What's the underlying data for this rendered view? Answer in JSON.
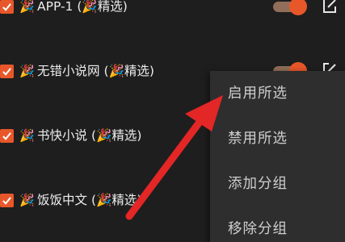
{
  "list": {
    "items": [
      {
        "name": "APP-1",
        "tag": "(",
        "tag_label": "精选",
        "tag_close": ")",
        "checked": true
      },
      {
        "name": "无错小说网",
        "tag": "(",
        "tag_label": "精选",
        "tag_close": ")",
        "checked": true
      },
      {
        "name": "书快小说",
        "tag": "(",
        "tag_label": "精选",
        "tag_close": ")",
        "checked": true
      },
      {
        "name": "饭饭中文",
        "tag": "(",
        "tag_label": "精选",
        "tag_close": ")",
        "checked": true
      }
    ]
  },
  "context_menu": {
    "items": [
      "启用所选",
      "禁用所选",
      "添加分组",
      "移除分组"
    ]
  },
  "icons": {
    "party": "party-popper-icon",
    "check": "check-icon",
    "edit": "edit-icon"
  },
  "colors": {
    "accent": "#e8572a",
    "arrow": "#e32626",
    "menu_bg": "#2e2e2e",
    "bg": "#1e1e1e"
  }
}
